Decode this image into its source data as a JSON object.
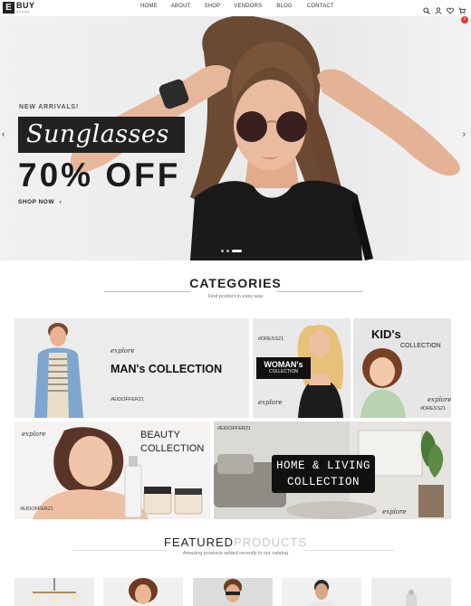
{
  "brand": {
    "mark": "E",
    "name": "BUY",
    "tagline": "STORE"
  },
  "nav": [
    "HOME",
    "ABOUT",
    "SHOP",
    "VENDORS",
    "BLOG",
    "CONTACT"
  ],
  "header_icons": [
    "search-icon",
    "user-icon",
    "heart-icon",
    "cart-icon"
  ],
  "cart_count": "0",
  "hero": {
    "eyebrow": "NEW ARRIVALS!",
    "headline": "Sunglasses",
    "offer": "70% OFF",
    "cta": "SHOP NOW",
    "cta_icon": "chevron-right-icon",
    "prev": "‹",
    "next": "›",
    "slides": 3,
    "active_slide": 2
  },
  "categories": {
    "title": "CATEGORIES",
    "subtitle": "Find product in easy way",
    "tiles": {
      "man": {
        "explore": "explore",
        "title": "MAN's COLLECTION",
        "tag": "#EIDOFFER21"
      },
      "woman": {
        "tag": "#DRESS21",
        "title": "WOMAN's",
        "subtitle": "COLLECTION",
        "explore": "explore"
      },
      "kid": {
        "title": "KID's",
        "subtitle": "COLLECTION",
        "explore": "explore",
        "tag": "#DRESS21"
      },
      "beauty": {
        "explore": "explore",
        "title_line1": "BEAUTY",
        "title_line2": "COLLECTION",
        "tag": "#EIDOFFER21"
      },
      "home": {
        "tag": "#EIDOFFER21",
        "title_line1": "HOME & LIVING",
        "title_line2": "COLLECTION",
        "explore": "explore"
      }
    }
  },
  "featured": {
    "title_bold": "FEATURED",
    "title_light": "PRODUCTS",
    "subtitle": "Amazing products added recently in our catalog"
  },
  "colors": {
    "accent": "#e53935",
    "dark": "#111111",
    "text": "#222222"
  }
}
